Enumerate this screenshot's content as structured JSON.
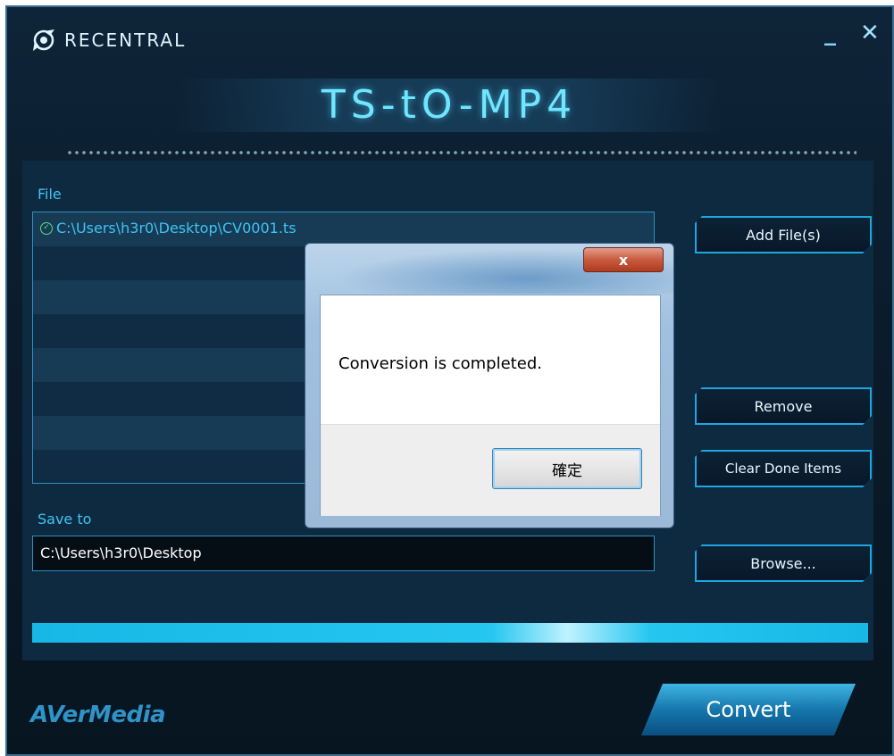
{
  "app": {
    "logo_text": "RECENTRAL",
    "title": "TS-tO-MP4",
    "minimize_glyph": "_",
    "close_glyph": "✕",
    "brand": "AVerMedia"
  },
  "file_section": {
    "label": "File",
    "files": [
      {
        "path": "C:\\Users\\h3r0\\Desktop\\CV0001.ts",
        "status": "done"
      }
    ]
  },
  "buttons": {
    "add_files": "Add File(s)",
    "remove": "Remove",
    "clear_done": "Clear Done Items",
    "browse": "Browse...",
    "convert": "Convert"
  },
  "save_section": {
    "label": "Save to",
    "path": "C:\\Users\\h3r0\\Desktop"
  },
  "progress": {
    "fraction": 1.0
  },
  "dialog": {
    "close_glyph": "x",
    "message": "Conversion is completed.",
    "ok_label": "確定"
  },
  "colors": {
    "accent": "#3fc4f3",
    "title_glow": "#6fe6ff",
    "status_done": "#5be081"
  }
}
